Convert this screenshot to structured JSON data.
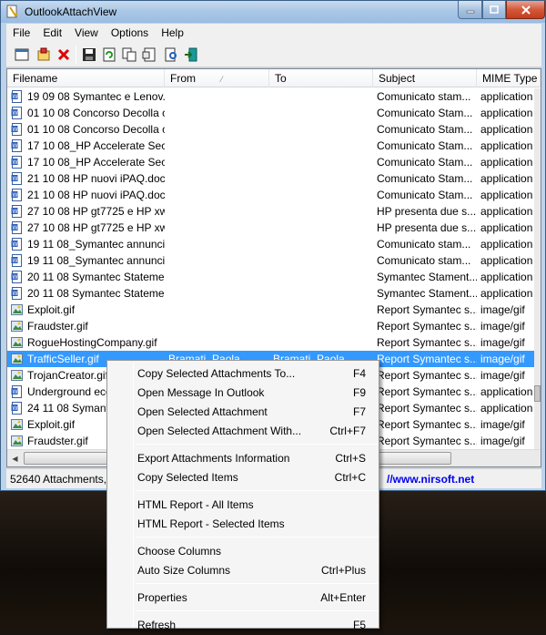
{
  "window": {
    "title": "OutlookAttachView",
    "menu": [
      "File",
      "Edit",
      "View",
      "Options",
      "Help"
    ]
  },
  "columns": [
    "Filename",
    "From",
    "To",
    "Subject",
    "MIME Type"
  ],
  "rows": [
    {
      "filename": "19 09 08 Symantec e Lenov...",
      "from": "",
      "to": "",
      "subject": "Comunicato stam...",
      "mime": "application",
      "icon": "doc-icon"
    },
    {
      "filename": "01 10 08 Concorso Decolla c...",
      "from": "",
      "to": "",
      "subject": "Comunicato Stam...",
      "mime": "application",
      "icon": "doc-icon"
    },
    {
      "filename": "01 10 08 Concorso Decolla c...",
      "from": "",
      "to": "",
      "subject": "Comunicato Stam...",
      "mime": "application",
      "icon": "doc-icon"
    },
    {
      "filename": "17 10 08_HP Accelerate Sec...",
      "from": "",
      "to": "",
      "subject": "Comunicato Stam...",
      "mime": "application",
      "icon": "doc-icon"
    },
    {
      "filename": "17 10 08_HP Accelerate Sec...",
      "from": "",
      "to": "",
      "subject": "Comunicato Stam...",
      "mime": "application",
      "icon": "doc-icon"
    },
    {
      "filename": "21 10 08 HP nuovi iPAQ.doc",
      "from": "",
      "to": "",
      "subject": "Comunicato Stam...",
      "mime": "application",
      "icon": "doc-icon"
    },
    {
      "filename": "21 10 08 HP nuovi iPAQ.doc",
      "from": "",
      "to": "",
      "subject": "Comunicato Stam...",
      "mime": "application",
      "icon": "doc-icon"
    },
    {
      "filename": "27 10 08 HP gt7725 e HP xw...",
      "from": "",
      "to": "",
      "subject": "HP presenta due s...",
      "mime": "application",
      "icon": "doc-icon"
    },
    {
      "filename": "27 10 08 HP gt7725 e HP xw...",
      "from": "",
      "to": "",
      "subject": "HP presenta due s...",
      "mime": "application",
      "icon": "doc-icon"
    },
    {
      "filename": "19 11 08_Symantec annunci...",
      "from": "",
      "to": "",
      "subject": "Comunicato stam...",
      "mime": "application",
      "icon": "doc-icon"
    },
    {
      "filename": "19 11 08_Symantec annunci...",
      "from": "",
      "to": "",
      "subject": "Comunicato stam...",
      "mime": "application",
      "icon": "doc-icon"
    },
    {
      "filename": "20 11 08 Symantec Stateme...",
      "from": "",
      "to": "",
      "subject": "Symantec Stament...",
      "mime": "application",
      "icon": "doc-icon"
    },
    {
      "filename": "20 11 08 Symantec Stateme...",
      "from": "",
      "to": "",
      "subject": "Symantec Stament...",
      "mime": "application",
      "icon": "doc-icon"
    },
    {
      "filename": "Exploit.gif",
      "from": "",
      "to": "",
      "subject": "Report Symantec s...",
      "mime": "image/gif",
      "icon": "gif-icon"
    },
    {
      "filename": "Fraudster.gif",
      "from": "",
      "to": "",
      "subject": "Report Symantec s...",
      "mime": "image/gif",
      "icon": "gif-icon"
    },
    {
      "filename": "RogueHostingCompany.gif",
      "from": "",
      "to": "",
      "subject": "Report Symantec s...",
      "mime": "image/gif",
      "icon": "gif-icon"
    },
    {
      "filename": "TrafficSeller.gif",
      "from": "Bramati, Paola",
      "to": "Bramati, Paola",
      "subject": "Report Symantec s...",
      "mime": "image/gif",
      "icon": "gif-icon",
      "selected": true
    },
    {
      "filename": "TrojanCreator.gif",
      "from": "",
      "to": "",
      "subject": "Report Symantec s...",
      "mime": "image/gif",
      "icon": "gif-icon"
    },
    {
      "filename": "Underground eco...",
      "from": "",
      "to": "",
      "subject": "Report Symantec s...",
      "mime": "application",
      "icon": "doc-icon"
    },
    {
      "filename": "24 11 08 Symantec...",
      "from": "",
      "to": "",
      "subject": "Report Symantec s...",
      "mime": "application",
      "icon": "doc-icon"
    },
    {
      "filename": "Exploit.gif",
      "from": "",
      "to": "",
      "subject": "Report Symantec s...",
      "mime": "image/gif",
      "icon": "gif-icon"
    },
    {
      "filename": "Fraudster.gif",
      "from": "",
      "to": "",
      "subject": "Report Symantec s...",
      "mime": "image/gif",
      "icon": "gif-icon"
    }
  ],
  "status": {
    "count": "52640 Attachments, 1",
    "link": "//www.nirsoft.net"
  },
  "context_menu": {
    "groups": [
      [
        {
          "label": "Copy Selected Attachments To...",
          "shortcut": "F4"
        },
        {
          "label": "Open Message In Outlook",
          "shortcut": "F9"
        },
        {
          "label": "Open Selected Attachment",
          "shortcut": "F7"
        },
        {
          "label": "Open Selected Attachment With...",
          "shortcut": "Ctrl+F7"
        }
      ],
      [
        {
          "label": "Export Attachments Information",
          "shortcut": "Ctrl+S"
        },
        {
          "label": "Copy Selected Items",
          "shortcut": "Ctrl+C"
        }
      ],
      [
        {
          "label": "HTML Report - All Items",
          "shortcut": ""
        },
        {
          "label": "HTML Report - Selected Items",
          "shortcut": ""
        }
      ],
      [
        {
          "label": "Choose Columns",
          "shortcut": ""
        },
        {
          "label": "Auto Size Columns",
          "shortcut": "Ctrl+Plus"
        }
      ],
      [
        {
          "label": "Properties",
          "shortcut": "Alt+Enter"
        }
      ],
      [
        {
          "label": "Refresh",
          "shortcut": "F5"
        }
      ]
    ]
  },
  "colors": {
    "selection": "#3399ff",
    "link": "#0000ee",
    "title_bar": "#a9c6e6"
  }
}
